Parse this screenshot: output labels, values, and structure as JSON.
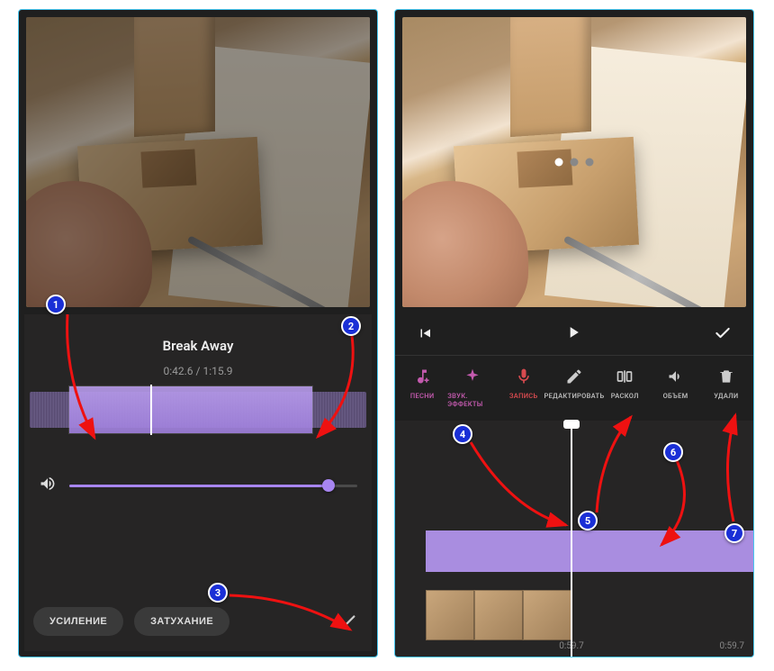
{
  "left": {
    "track_title": "Break Away",
    "time": "0:42.6 / 1:15.9",
    "volume_percent": 90,
    "buttons": {
      "gain": "УСИЛЕНИЕ",
      "fade": "ЗАТУХАНИЕ"
    }
  },
  "right": {
    "tools": {
      "songs": "ПЕСНИ",
      "sfx": "ЗВУК. ЭФФЕКТЫ",
      "record": "ЗАПИСЬ",
      "edit": "РЕДАКТИРОВАТЬ",
      "split": "РАСКОЛ",
      "volume": "ОБЪЕМ",
      "delete": "УДАЛИ"
    },
    "timeline": {
      "playhead_time": "0:59.7",
      "end_time": "0:59.7"
    }
  },
  "annotations": {
    "b1": "1",
    "b2": "2",
    "b3": "3",
    "b4": "4",
    "b5": "5",
    "b6": "6",
    "b7": "7"
  }
}
